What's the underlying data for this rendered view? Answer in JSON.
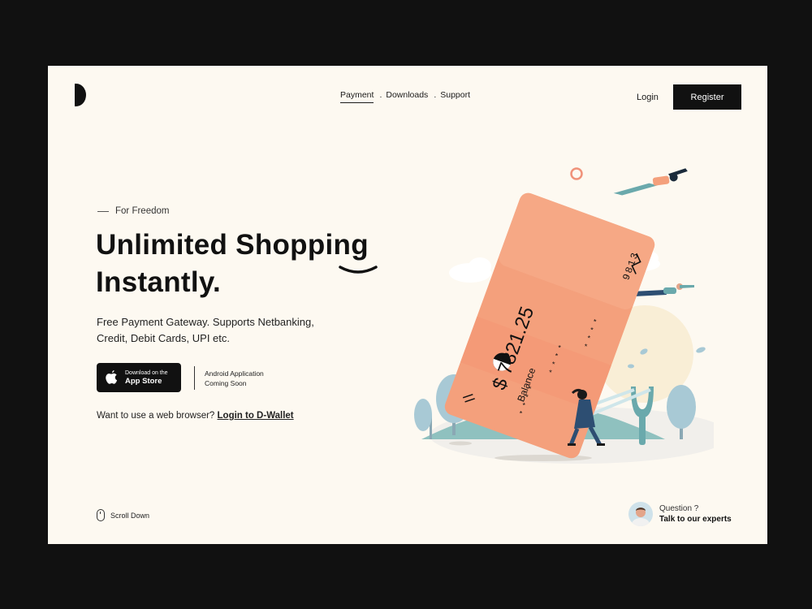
{
  "nav": {
    "items": [
      {
        "label": "Payment",
        "active": true
      },
      {
        "label": "Downloads",
        "active": false
      },
      {
        "label": "Support",
        "active": false
      }
    ],
    "separator": "."
  },
  "auth": {
    "login": "Login",
    "register": "Register"
  },
  "hero": {
    "eyebrow": "For Freedom",
    "headline_line1": "Unlimited Shopping",
    "headline_line2": "Instantly.",
    "subtitle": "Free Payment Gateway. Supports Netbanking, Credit, Debit Cards, UPI etc."
  },
  "appstore": {
    "line1": "Download on the",
    "line2": "App Store"
  },
  "android": {
    "line1": "Android Application",
    "line2": "Coming Soon"
  },
  "browser": {
    "prefix": "Want to use a web browser?",
    "link": "Login to D-Wallet"
  },
  "scroll": {
    "label": "Scroll Down"
  },
  "expert": {
    "question": "Question ?",
    "cta": "Talk to our experts"
  },
  "card": {
    "number": "9813",
    "stars": "* * * *",
    "amount": "$ 7821.25",
    "label": "Balance"
  },
  "colors": {
    "page_bg": "#fdf9f1",
    "outer_bg": "#111111",
    "card": "#f4a07c",
    "teal": "#8fc1bf",
    "dark": "#111111"
  },
  "icons": [
    "logo-mark",
    "apple-icon",
    "mouse-icon",
    "avatar"
  ]
}
